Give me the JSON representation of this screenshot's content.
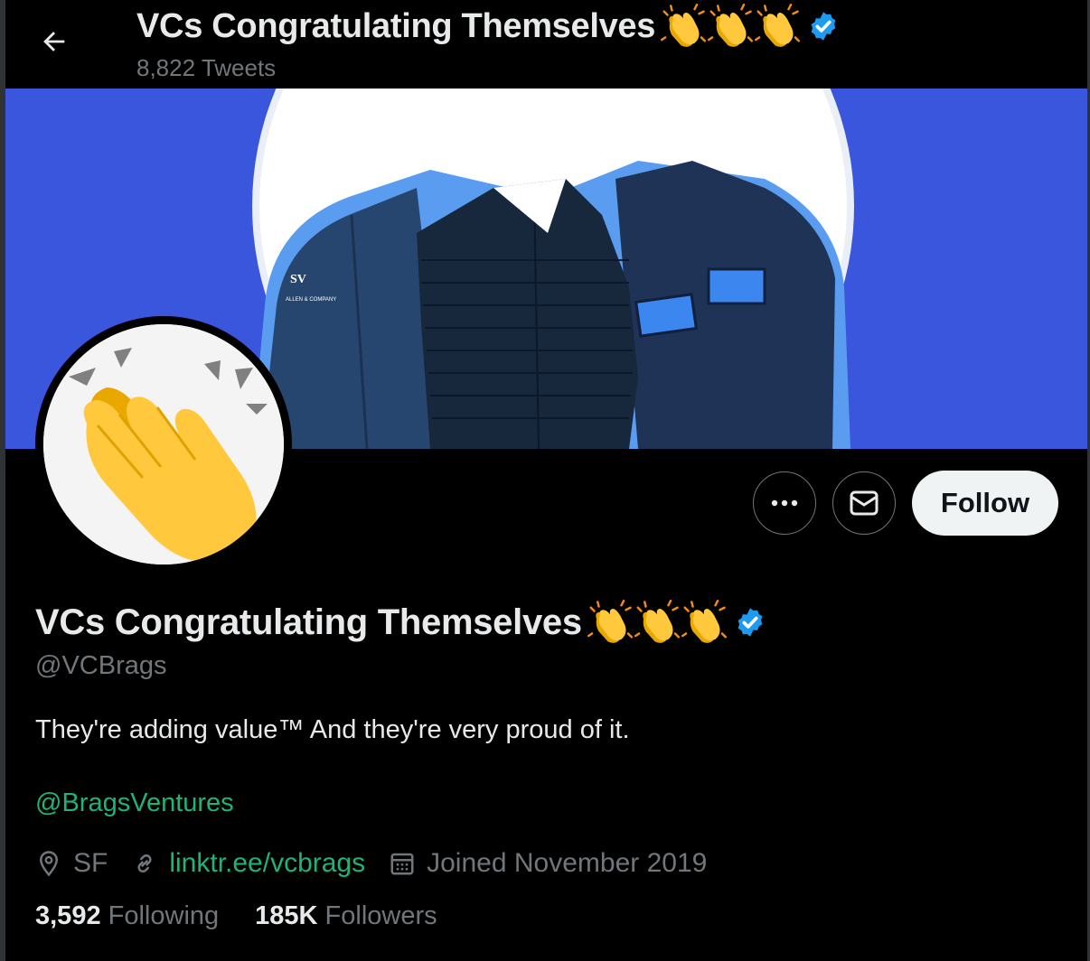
{
  "header": {
    "title": "VCs Congratulating Themselves",
    "tweet_count": "8,822 Tweets"
  },
  "profile": {
    "display_name": "VCs Congratulating Themselves",
    "handle": "@VCBrags",
    "bio": "They're adding value™ And they're very proud of it.",
    "bio_mention": "@BragsVentures",
    "location": "SF",
    "website": "linktr.ee/vcbrags",
    "joined": "Joined November 2019",
    "following_count": "3,592",
    "following_label": "Following",
    "followers_count": "185K",
    "followers_label": "Followers"
  },
  "actions": {
    "follow_label": "Follow"
  },
  "colors": {
    "background": "#000000",
    "banner_blue": "#3a56dc",
    "link_green": "#1fb377",
    "verified_blue": "#1d9bf0",
    "muted_text": "#71767b"
  },
  "icons": [
    "back-arrow-icon",
    "clap-emoji-icon",
    "verified-badge-icon",
    "more-icon",
    "message-icon",
    "location-icon",
    "link-icon",
    "calendar-icon"
  ]
}
